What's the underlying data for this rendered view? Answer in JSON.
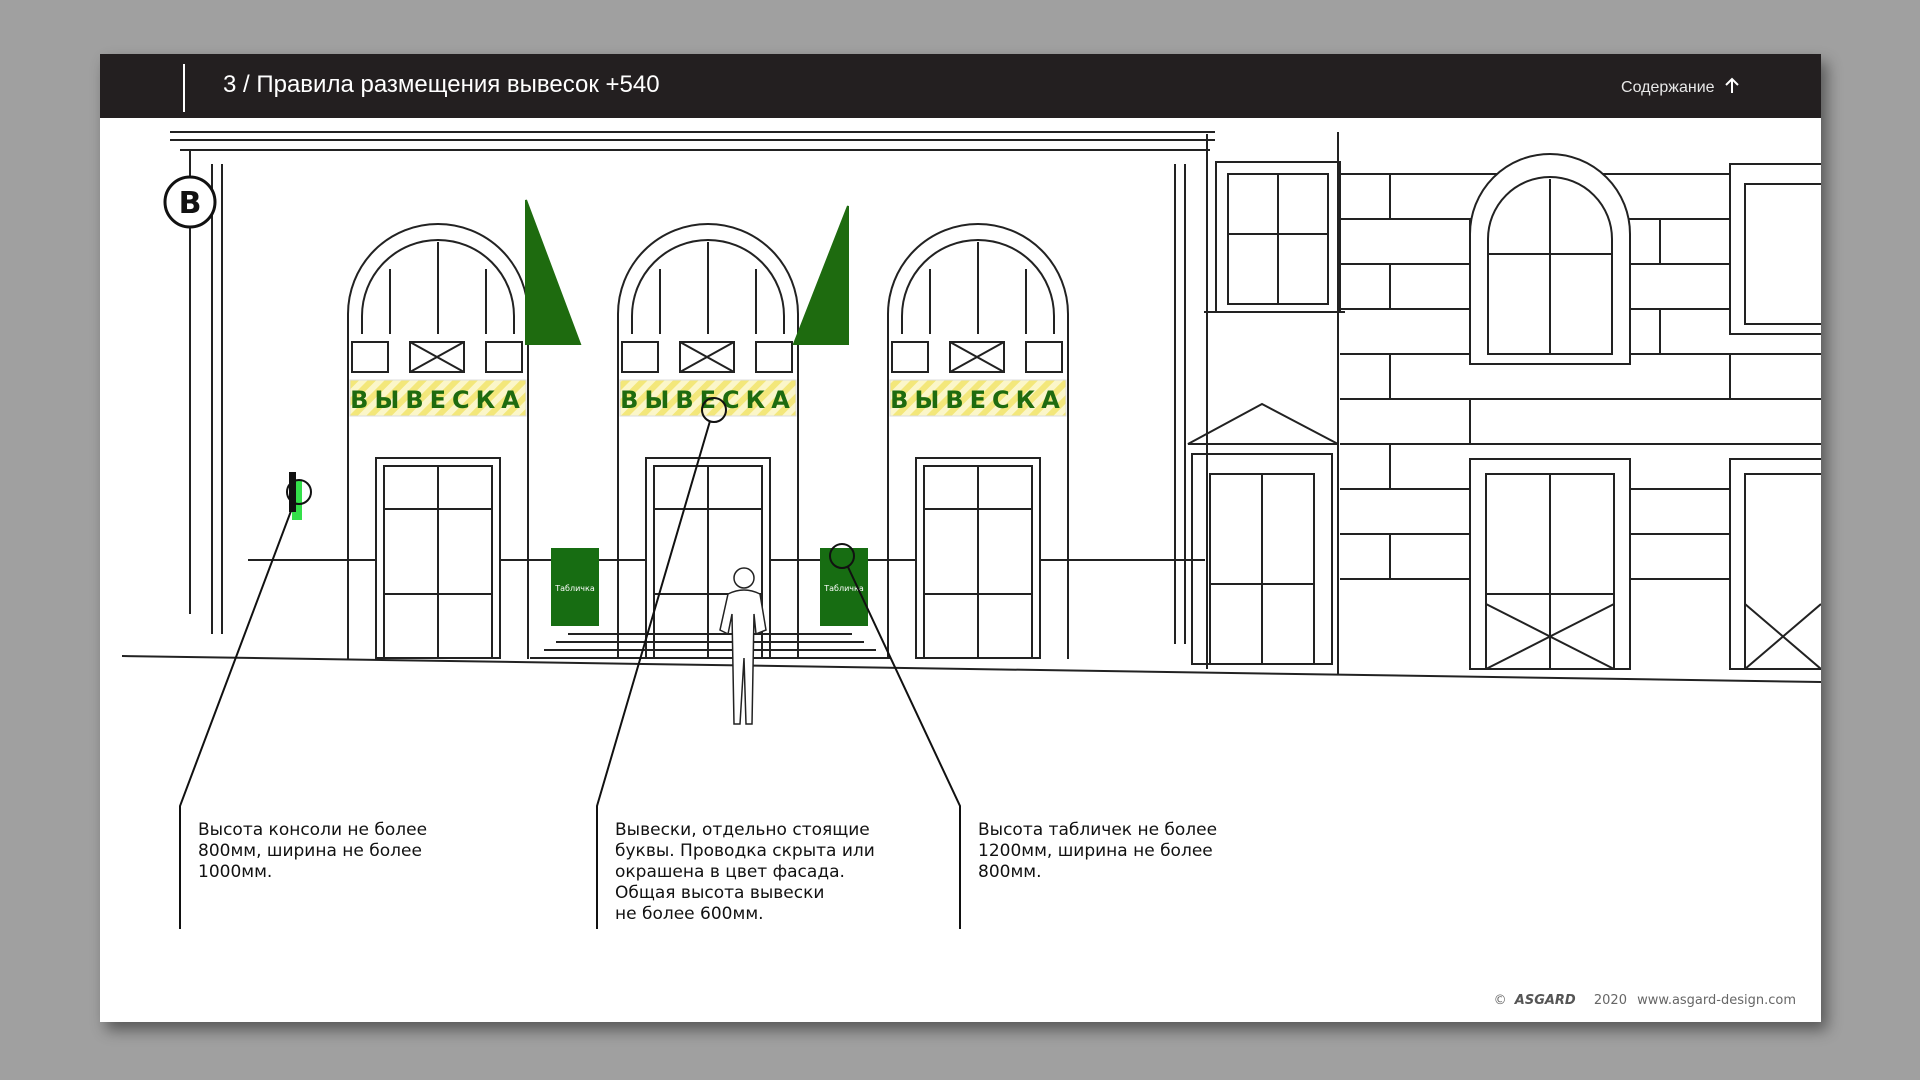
{
  "header": {
    "title": "3 / Правила размещения вывесок +540",
    "toc_label": "Содержание"
  },
  "drawing": {
    "marker_letter": "В",
    "sign_text": "ВЫВЕСКА",
    "plaque_text": "Табличка"
  },
  "notes": {
    "console": [
      "Высота консоли не более",
      "800мм, ширина не более",
      "1000мм."
    ],
    "signs": [
      "Вывески, отдельно стоящие",
      "буквы. Проводка скрыта или",
      "окрашена в цвет фасада.",
      "Общая высота вывески",
      "не более 600мм."
    ],
    "plaques": [
      "Высота табличек не более",
      "1200мм, ширина не более",
      "800мм."
    ]
  },
  "footer": {
    "copyright": "©",
    "brand": "ASGARD",
    "year": "2020",
    "url": "www.asgard-design.com"
  },
  "colors": {
    "header_bg": "#231f20",
    "sign_green": "#1e6b0f",
    "plaque_green": "#176d12",
    "sign_stripe_yellow": "#f3e77a",
    "console_light_green": "#34e04a"
  }
}
